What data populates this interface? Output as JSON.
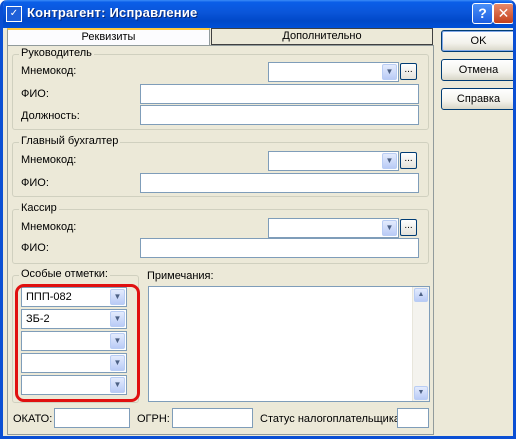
{
  "window": {
    "title": "Контрагент: Исправление",
    "help_button": "?",
    "close_button": "✕"
  },
  "tabs": [
    {
      "label": "Реквизиты",
      "active": true
    },
    {
      "label": "Дополнительно",
      "active": false
    }
  ],
  "buttons": {
    "ok": "OK",
    "cancel": "Отмена",
    "help": "Справка"
  },
  "director": {
    "legend": "Руководитель",
    "mnemocode_label": "Мнемокод:",
    "mnemocode_value": "",
    "fio_label": "ФИО:",
    "fio_value": "",
    "position_label": "Должность:",
    "position_value": ""
  },
  "chief_accountant": {
    "legend": "Главный бухгалтер",
    "mnemocode_label": "Мнемокод:",
    "mnemocode_value": "",
    "fio_label": "ФИО:",
    "fio_value": ""
  },
  "cashier": {
    "legend": "Кассир",
    "mnemocode_label": "Мнемокод:",
    "mnemocode_value": "",
    "fio_label": "ФИО:",
    "fio_value": ""
  },
  "special_marks": {
    "label": "Особые отметки:",
    "items": [
      "ППП-082",
      "ЗБ-2",
      "",
      "",
      ""
    ]
  },
  "notes": {
    "label": "Примечания:",
    "value": ""
  },
  "footer": {
    "okato_label": "ОКАТО:",
    "okato_value": "",
    "ogrn_label": "ОГРН:",
    "ogrn_value": "",
    "taxpayer_status_label": "Статус налогоплательщика:",
    "taxpayer_status_value": ""
  },
  "icons": {
    "dropdown": "chevron-down-icon",
    "ellipsis": "ellipsis-icon",
    "scroll_up": "arrow-up-icon",
    "scroll_down": "arrow-down-icon"
  },
  "colors": {
    "titlebar": "#0a55d9",
    "highlight": "#e01010",
    "panel": "#ece9d8"
  }
}
